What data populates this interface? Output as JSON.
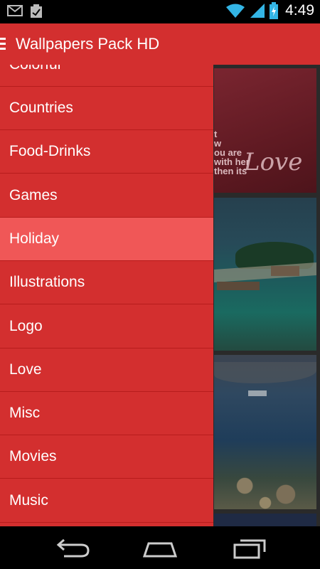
{
  "status_bar": {
    "time": "4:49",
    "icons": [
      "gmail-icon",
      "clipboard-icon",
      "wifi-icon",
      "signal-icon",
      "battery-icon"
    ]
  },
  "action_bar": {
    "title": "Wallpapers Pack HD",
    "background": "#d32f2f",
    "menu_icon": "hamburger-icon"
  },
  "drawer": {
    "background": "#d32f2f",
    "selected_color": "#f05757",
    "items": [
      {
        "label": "Colorful"
      },
      {
        "label": "Countries"
      },
      {
        "label": "Food-Drinks"
      },
      {
        "label": "Games"
      },
      {
        "label": "Holiday",
        "selected": true
      },
      {
        "label": "Illustrations"
      },
      {
        "label": "Logo"
      },
      {
        "label": "Love"
      },
      {
        "label": "Misc"
      },
      {
        "label": "Movies"
      },
      {
        "label": "Music"
      }
    ]
  },
  "thumbnails": {
    "love": {
      "lines": [
        "t",
        "w",
        "ou are",
        "with her",
        "then its"
      ],
      "script": "Love"
    }
  },
  "nav_bar": {
    "buttons": [
      "back-icon",
      "home-icon",
      "recents-icon"
    ]
  }
}
